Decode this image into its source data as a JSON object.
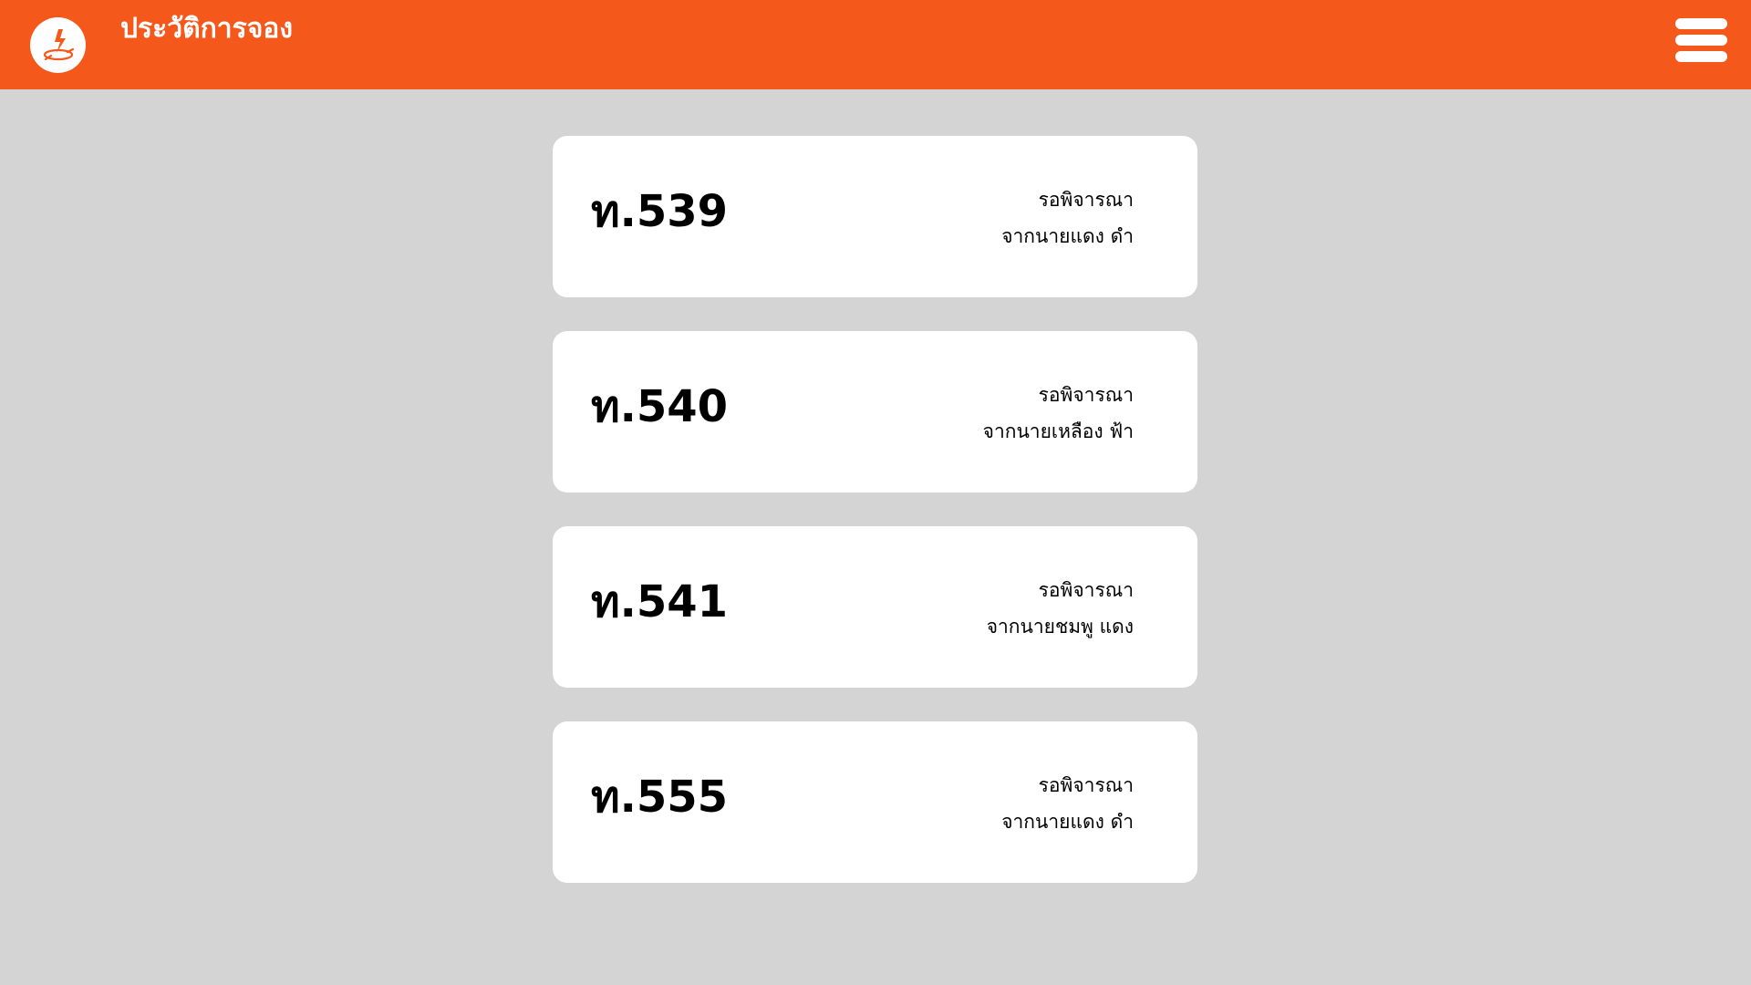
{
  "header": {
    "title": "ประวัติการจอง",
    "logo_icon": "bolt-badge-icon",
    "menu_icon": "hamburger-menu-icon",
    "accent_color": "#f4581b"
  },
  "bookings": [
    {
      "code": "ท.539",
      "status": "รอพิจารณา",
      "from": "จากนายแดง ดำ"
    },
    {
      "code": "ท.540",
      "status": "รอพิจารณา",
      "from": "จากนายเหลือง ฟ้า"
    },
    {
      "code": "ท.541",
      "status": "รอพิจารณา",
      "from": "จากนายชมพู แดง"
    },
    {
      "code": "ท.555",
      "status": "รอพิจารณา",
      "from": "จากนายแดง ดำ"
    }
  ]
}
